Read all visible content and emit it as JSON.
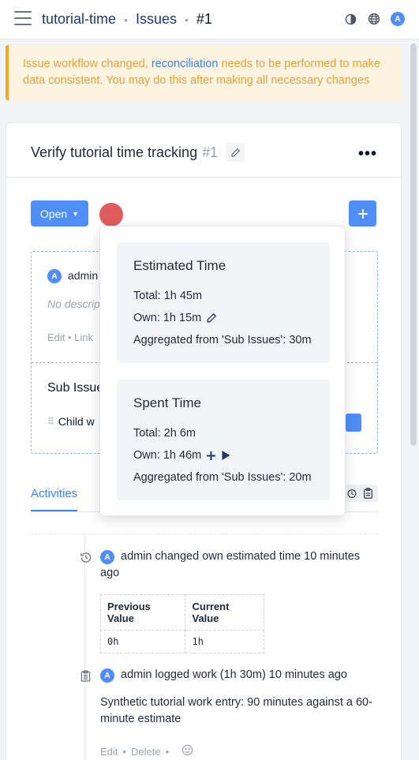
{
  "header": {
    "project": "tutorial-time",
    "section": "Issues",
    "issue_number": "#1",
    "avatar_initial": "A"
  },
  "banner": {
    "text_before": "Issue workflow changed, ",
    "link": "reconciliation",
    "text_after": " needs to be performed to make data consistent. You may do this after making all necessary changes"
  },
  "issue": {
    "title": "Verify tutorial time tracking",
    "number": "#1",
    "status": "Open",
    "accent_color": "#4f8ef7",
    "status_dot_color": "#e05a5e"
  },
  "description": {
    "avatar_initial": "A",
    "author": "admin",
    "placeholder": "No description",
    "actions": "Edit • Link"
  },
  "sub_issues": {
    "title": "Sub Issues",
    "child": "Child w"
  },
  "tabs": {
    "activities": "Activities"
  },
  "popover": {
    "estimated": {
      "title": "Estimated Time",
      "total": "Total: 1h 45m",
      "own": "Own: 1h 15m",
      "aggregated": "Aggregated from 'Sub Issues': 30m"
    },
    "spent": {
      "title": "Spent Time",
      "total": "Total: 2h 6m",
      "own": "Own: 1h 46m",
      "aggregated": "Aggregated from 'Sub Issues': 20m"
    }
  },
  "activities": [
    {
      "icon": "history-icon",
      "avatar_initial": "A",
      "user": "admin",
      "text": "changed own estimated time 10 minutes ago",
      "table": {
        "headers": [
          "Previous Value",
          "Current Value"
        ],
        "row": [
          "0h",
          "1h"
        ]
      }
    },
    {
      "icon": "clipboard-icon",
      "avatar_initial": "A",
      "user": "admin",
      "text": "logged work (1h 30m) 10 minutes ago",
      "body": "Synthetic tutorial work entry: 90 minutes against a 60-minute estimate",
      "footer_edit": "Edit",
      "footer_delete": "Delete"
    }
  ]
}
